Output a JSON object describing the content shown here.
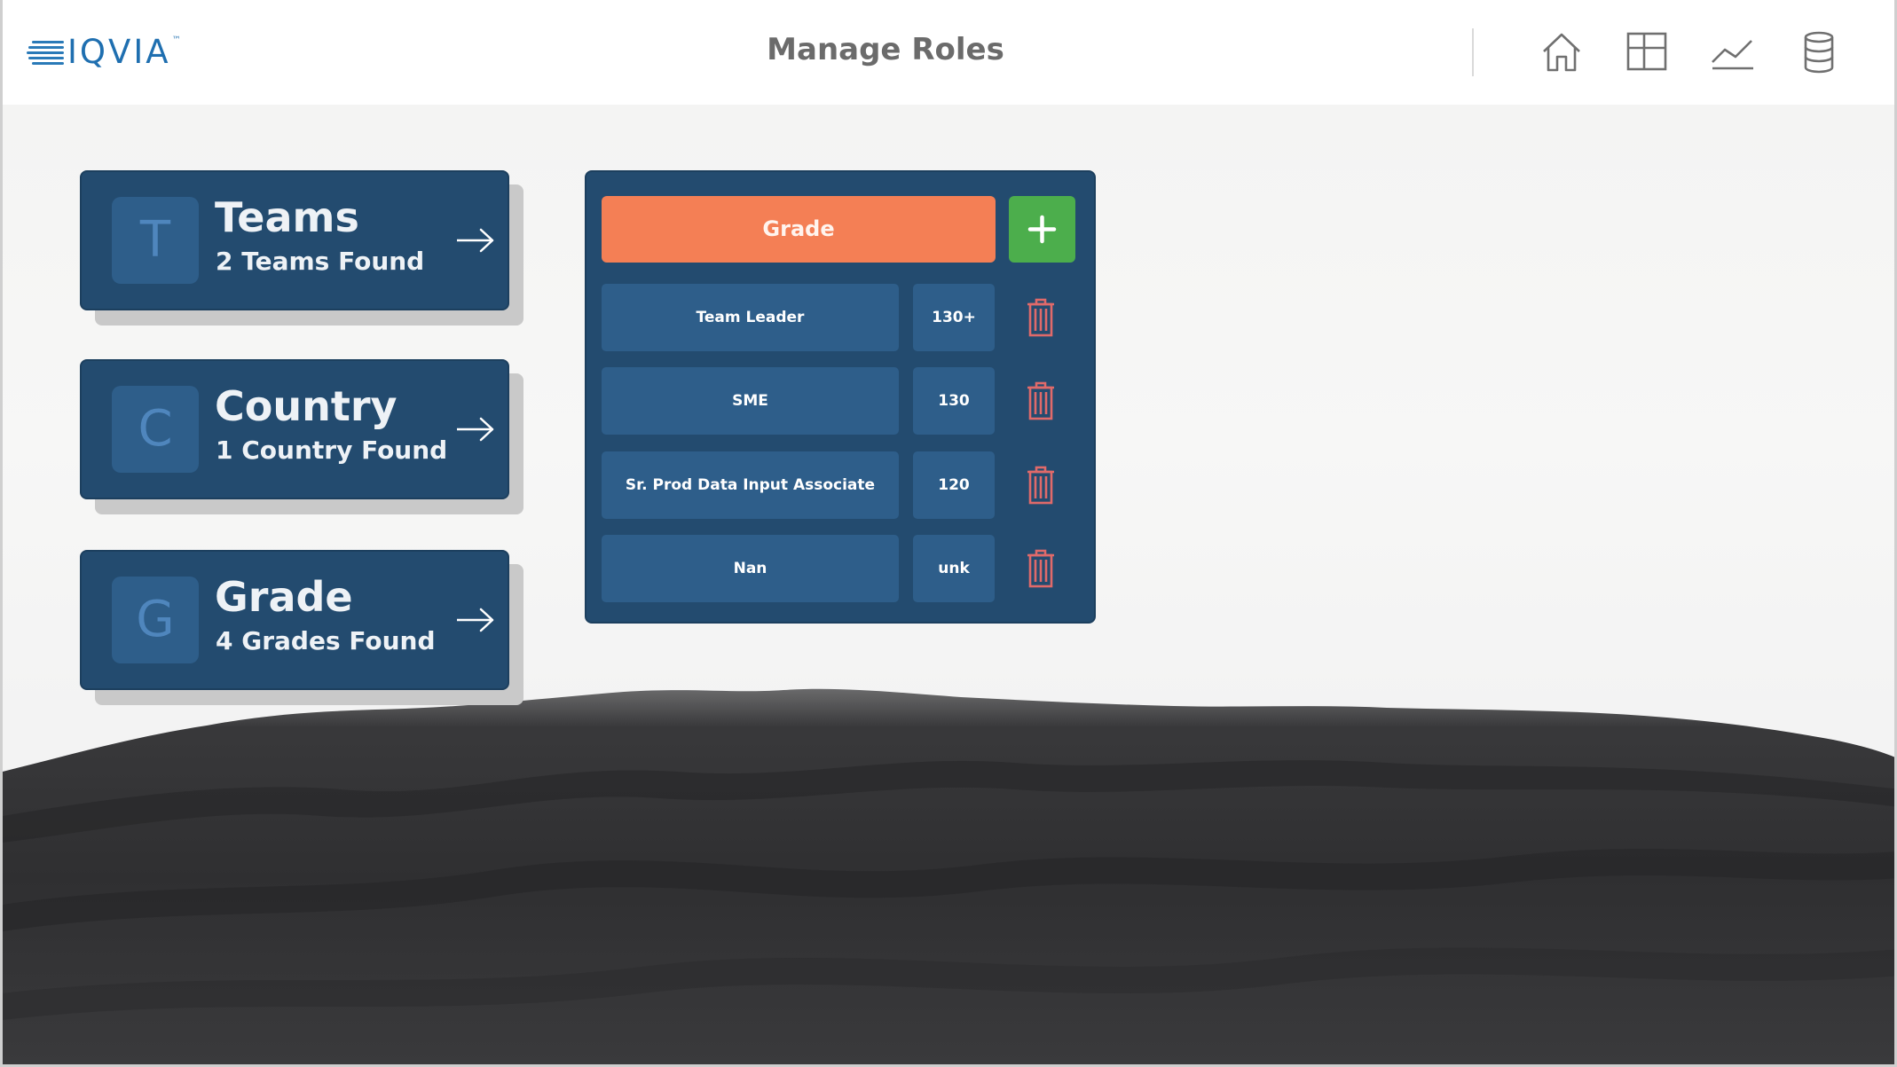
{
  "header": {
    "logo_text": "IQVIA",
    "logo_tm": "™",
    "title": "Manage Roles",
    "nav_icons": [
      "home-icon",
      "layout-icon",
      "trend-chart-icon",
      "database-icon"
    ]
  },
  "cards": [
    {
      "letter": "T",
      "title": "Teams",
      "subtitle": "2 Teams Found"
    },
    {
      "letter": "C",
      "title": "Country",
      "subtitle": "1 Country Found"
    },
    {
      "letter": "G",
      "title": "Grade",
      "subtitle": "4 Grades Found"
    }
  ],
  "grade_panel": {
    "header_label": "Grade",
    "add_label": "+",
    "rows": [
      {
        "name": "Team Leader",
        "code": "130+"
      },
      {
        "name": "SME",
        "code": "130"
      },
      {
        "name": "Sr. Prod Data Input Associate",
        "code": "120"
      },
      {
        "name": "Nan",
        "code": "unk"
      }
    ]
  },
  "colors": {
    "card_bg": "#234b6f",
    "tile_bg": "#2e5e8a",
    "accent_orange": "#f47f55",
    "accent_green": "#4cae4c",
    "trash_red": "#e06a6a",
    "brand_blue": "#1f6fb0"
  }
}
